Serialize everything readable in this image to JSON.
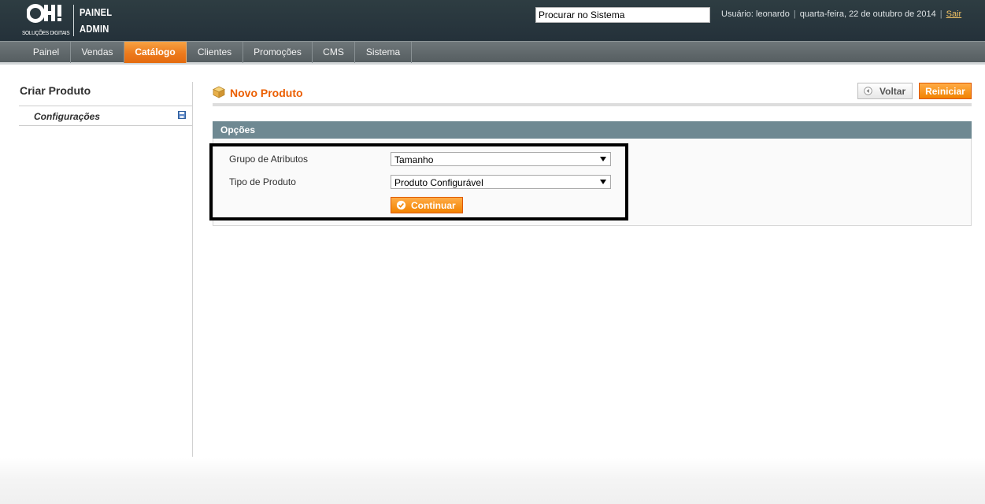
{
  "header": {
    "logo_text": "OH!",
    "logo_subtitle": "SOLUÇÕES DIGITAIS",
    "panel_title_line1": "PAINEL",
    "panel_title_line2": "ADMIN",
    "search_value": "Procurar no Sistema",
    "user_label": "Usuário: leonardo",
    "date_label": "quarta-feira, 22 de outubro de 2014",
    "logout_label": "Sair"
  },
  "nav": {
    "items": [
      {
        "label": "Painel"
      },
      {
        "label": "Vendas"
      },
      {
        "label": "Catálogo",
        "active": true
      },
      {
        "label": "Clientes"
      },
      {
        "label": "Promoções"
      },
      {
        "label": "CMS"
      },
      {
        "label": "Sistema"
      }
    ]
  },
  "sidebar": {
    "title": "Criar Produto",
    "items": [
      {
        "label": "Configurações"
      }
    ]
  },
  "main": {
    "page_title": "Novo Produto",
    "back_label": "Voltar",
    "reset_label": "Reiniciar",
    "fieldset_title": "Opções",
    "fields": [
      {
        "label": "Grupo de Atributos",
        "value": "Tamanho"
      },
      {
        "label": "Tipo de Produto",
        "value": "Produto Configurável"
      }
    ],
    "continue_label": "Continuar"
  },
  "colors": {
    "accent": "#eb5e00",
    "nav_active": "#ed7a1c",
    "fieldset_header": "#6f8992",
    "header_bg": "#2e3d42"
  }
}
